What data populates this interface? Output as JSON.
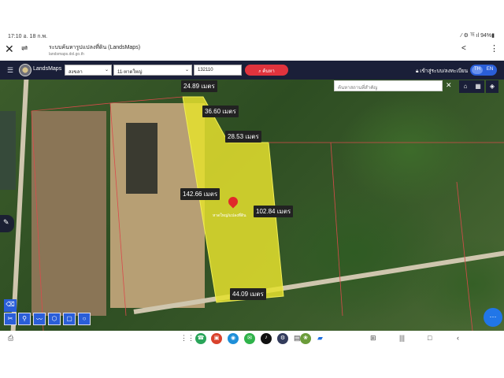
{
  "status_bar": {
    "time_date": "17:10  อ. 18 ก.พ.",
    "right": "⁄ ⚙ ᵀᴱ ıl 94%▮"
  },
  "browser": {
    "page_title": "ระบบค้นหารูปแปลงที่ดิน (LandsMaps)",
    "url": "landsmaps.dol.go.th"
  },
  "app": {
    "name": "LandsMaps",
    "province": "สงขลา",
    "district": "11-หาดใหญ่",
    "parcel_no": "132110",
    "search_label": "ค้นหา",
    "login_label": "เข้าสู่ระบบ/ลงทะเบียน",
    "lang_th": "TH",
    "lang_en": "EN"
  },
  "map": {
    "search_placeholder": "ค้นหาสถานที่สำคัญ",
    "parcel_label": "หาดใหญ่/แปลงที่ดิน",
    "dimensions": {
      "d1": "24.89 เมตร",
      "d2": "36.60 เมตร",
      "d3": "28.53 เมตร",
      "d4": "142.66 เมตร",
      "d5": "102.84 เมตร",
      "d6": "44.09 เมตร"
    },
    "parcel_color": "#e5e02e"
  }
}
